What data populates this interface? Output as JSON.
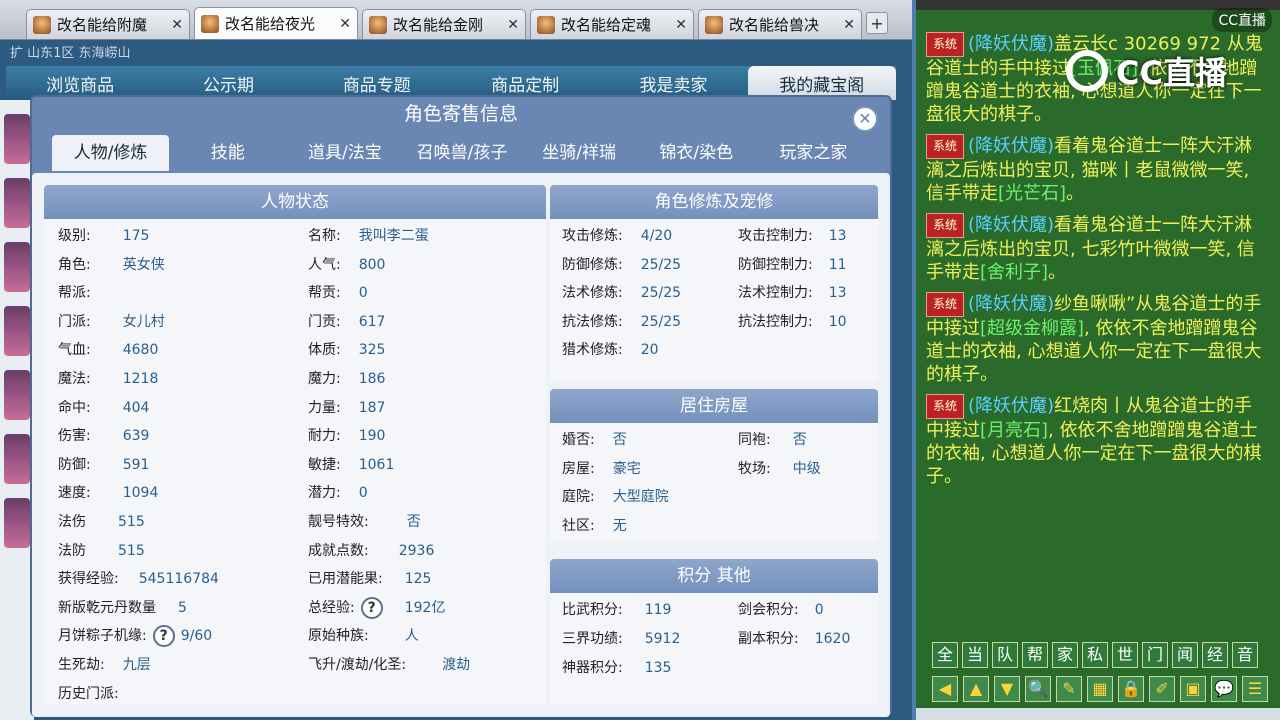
{
  "tabs": [
    {
      "label": "改名能给附魔",
      "active": false
    },
    {
      "label": "改名能给夜光",
      "active": true
    },
    {
      "label": "改名能给金刚",
      "active": false
    },
    {
      "label": "改名能给定魂",
      "active": false
    },
    {
      "label": "改名能给兽决",
      "active": false
    }
  ],
  "game": {
    "location_text": "扩 山东1区 东海崂山",
    "nav": [
      "浏览商品",
      "公示期",
      "商品专题",
      "商品定制",
      "我是卖家",
      "我的藏宝阁"
    ],
    "nav_active": 5
  },
  "panel": {
    "title": "角色寄售信息",
    "subtabs": [
      "人物/修炼",
      "技能",
      "道具/法宝",
      "召唤兽/孩子",
      "坐骑/祥瑞",
      "锦衣/染色",
      "玩家之家"
    ],
    "subtab_active": 0,
    "status": {
      "title": "人物状态",
      "left": [
        {
          "k": "级别:",
          "v": "175"
        },
        {
          "k": "角色:",
          "v": "英女侠"
        },
        {
          "k": "帮派:",
          "v": ""
        },
        {
          "k": "门派:",
          "v": "女儿村"
        },
        {
          "k": "气血:",
          "v": "4680"
        },
        {
          "k": "魔法:",
          "v": "1218"
        },
        {
          "k": "命中:",
          "v": "404"
        },
        {
          "k": "伤害:",
          "v": "639"
        },
        {
          "k": "防御:",
          "v": "591"
        },
        {
          "k": "速度:",
          "v": "1094"
        },
        {
          "k": "法伤",
          "v": "515"
        },
        {
          "k": "法防",
          "v": "515"
        },
        {
          "k": "获得经验:",
          "v": "545116784"
        },
        {
          "k": "新版乾元丹数量",
          "v": "5"
        },
        {
          "k": "月饼粽子机缘:",
          "v": "9/60"
        },
        {
          "k": "生死劫:",
          "v": "九层"
        },
        {
          "k": "历史门派:",
          "v": ""
        }
      ],
      "right": [
        {
          "k": "名称:",
          "v": "我叫李二蛋"
        },
        {
          "k": "人气:",
          "v": "800"
        },
        {
          "k": "帮贡:",
          "v": "0"
        },
        {
          "k": "门贡:",
          "v": "617"
        },
        {
          "k": "体质:",
          "v": "325"
        },
        {
          "k": "魔力:",
          "v": "186"
        },
        {
          "k": "力量:",
          "v": "187"
        },
        {
          "k": "耐力:",
          "v": "190"
        },
        {
          "k": "敏捷:",
          "v": "1061"
        },
        {
          "k": "潜力:",
          "v": "0"
        },
        {
          "k": "靓号特效:",
          "v": "否"
        },
        {
          "k": "成就点数:",
          "v": "2936"
        },
        {
          "k": "已用潜能果:",
          "v": "125"
        },
        {
          "k": "总经验:",
          "v": "192亿"
        },
        {
          "k": "原始种族:",
          "v": "人"
        },
        {
          "k": "飞升/渡劫/化圣:",
          "v": "渡劫"
        }
      ]
    },
    "cultivation": {
      "title": "角色修炼及宠修",
      "left": [
        {
          "k": "攻击修炼:",
          "v": "4/20"
        },
        {
          "k": "防御修炼:",
          "v": "25/25"
        },
        {
          "k": "法术修炼:",
          "v": "25/25"
        },
        {
          "k": "抗法修炼:",
          "v": "25/25"
        },
        {
          "k": "猎术修炼:",
          "v": "20"
        }
      ],
      "right": [
        {
          "k": "攻击控制力:",
          "v": "13"
        },
        {
          "k": "防御控制力:",
          "v": "11"
        },
        {
          "k": "法术控制力:",
          "v": "13"
        },
        {
          "k": "抗法控制力:",
          "v": "10"
        }
      ]
    },
    "house": {
      "title": "居住房屋",
      "rows": [
        [
          {
            "k": "婚否:",
            "v": "否"
          },
          {
            "k": "同袍:",
            "v": "否"
          }
        ],
        [
          {
            "k": "房屋:",
            "v": "豪宅"
          },
          {
            "k": "牧场:",
            "v": "中级"
          }
        ],
        [
          {
            "k": "庭院:",
            "v": "大型庭院"
          }
        ],
        [
          {
            "k": "社区:",
            "v": "无"
          }
        ]
      ]
    },
    "points": {
      "title": "积分 其他",
      "rows": [
        [
          {
            "k": "比武积分:",
            "v": "119"
          },
          {
            "k": "剑会积分:",
            "v": "0"
          }
        ],
        [
          {
            "k": "三界功绩:",
            "v": "5912"
          },
          {
            "k": "副本积分:",
            "v": "1620"
          }
        ],
        [
          {
            "k": "神器积分:",
            "v": "135"
          }
        ]
      ]
    }
  },
  "chat": {
    "corner_logo": "CC直播",
    "big_logo": "CC直播",
    "messages": [
      {
        "badge": "系统",
        "who": "(降妖伏魔)",
        "text": "盖云长c 30269 972 从鬼谷道士的手中接过",
        "item": "[玉佩石]",
        "tail": ", 依依不舍地蹭蹭鬼谷道士的衣袖, 心想道人你一定在下一盘很大的棋子。"
      },
      {
        "badge": "系统",
        "who": "(降妖伏魔)",
        "text": "看着鬼谷道士一阵大汗淋漓之后炼出的宝贝, 猫咪丨老鼠微微一笑, 信手带走",
        "item": "[光芒石]",
        "tail": "。"
      },
      {
        "badge": "系统",
        "who": "(降妖伏魔)",
        "text": "看着鬼谷道士一阵大汗淋漓之后炼出的宝贝, 七彩竹叶微微一笑, 信手带走",
        "item": "[舍利子]",
        "tail": "。"
      },
      {
        "badge": "系统",
        "who": "(降妖伏魔)",
        "text": "纱鱼啾啾”从鬼谷道士的手中接过",
        "item": "[超级金柳露]",
        "tail": ", 依依不舍地蹭蹭鬼谷道士的衣袖, 心想道人你一定在下一盘很大的棋子。"
      },
      {
        "badge": "系统",
        "who": "(降妖伏魔)",
        "text": "红烧肉丨从鬼谷道士的手中接过",
        "item": "[月亮石]",
        "tail": ", 依依不舍地蹭蹭鬼谷道士的衣袖, 心想道人你一定在下一盘很大的棋子。"
      }
    ],
    "channels": [
      "全",
      "当",
      "队",
      "帮",
      "家",
      "私",
      "世",
      "门",
      "闻",
      "经",
      "音"
    ],
    "tools": [
      "◀",
      "▲",
      "▼",
      "🔍",
      "✎",
      "▦",
      "🔒",
      "✐",
      "▣",
      "💬",
      "☰"
    ]
  }
}
